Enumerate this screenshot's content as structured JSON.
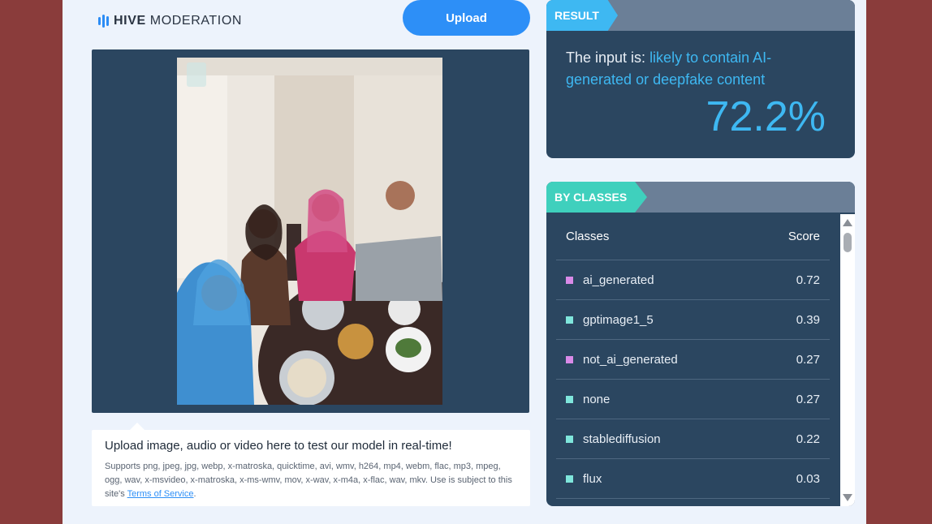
{
  "logo": {
    "brand": "HIVE",
    "product": "MODERATION"
  },
  "upload_button": "Upload",
  "info": {
    "title": "Upload image, audio or video here to test our model in real-time!",
    "supports": "Supports png, jpeg, jpg, webp, x-matroska, quicktime, avi, wmv, h264, mp4, webm, flac, mp3, mpeg, ogg, wav, x-msvideo, x-matroska, x-ms-wmv, mov, x-wav, x-m4a, x-flac, wav, mkv. Use is subject to this site's",
    "terms_link": "Terms of Service",
    "end": "."
  },
  "result": {
    "header": "RESULT",
    "prefix": "The input is: ",
    "verdict": "likely to contain AI-generated or deepfake content",
    "score": "72.2%",
    "accent": "#3eb8f2"
  },
  "by_classes": {
    "header": "BY CLASSES",
    "col_classes": "Classes",
    "col_score": "Score",
    "rows": [
      {
        "name": "ai_generated",
        "score": "0.72",
        "color": "#d98ae8"
      },
      {
        "name": "gptimage1_5",
        "score": "0.39",
        "color": "#7fe6dc"
      },
      {
        "name": "not_ai_generated",
        "score": "0.27",
        "color": "#d98ae8"
      },
      {
        "name": "none",
        "score": "0.27",
        "color": "#7fe6dc"
      },
      {
        "name": "stablediffusion",
        "score": "0.22",
        "color": "#7fe6dc"
      },
      {
        "name": "flux",
        "score": "0.03",
        "color": "#7fe6dc"
      }
    ]
  },
  "colors": {
    "page_bg": "#8a3c3b",
    "panel": "#2b4660",
    "primary": "#2d8ff7",
    "teal": "#3fd0bd"
  }
}
